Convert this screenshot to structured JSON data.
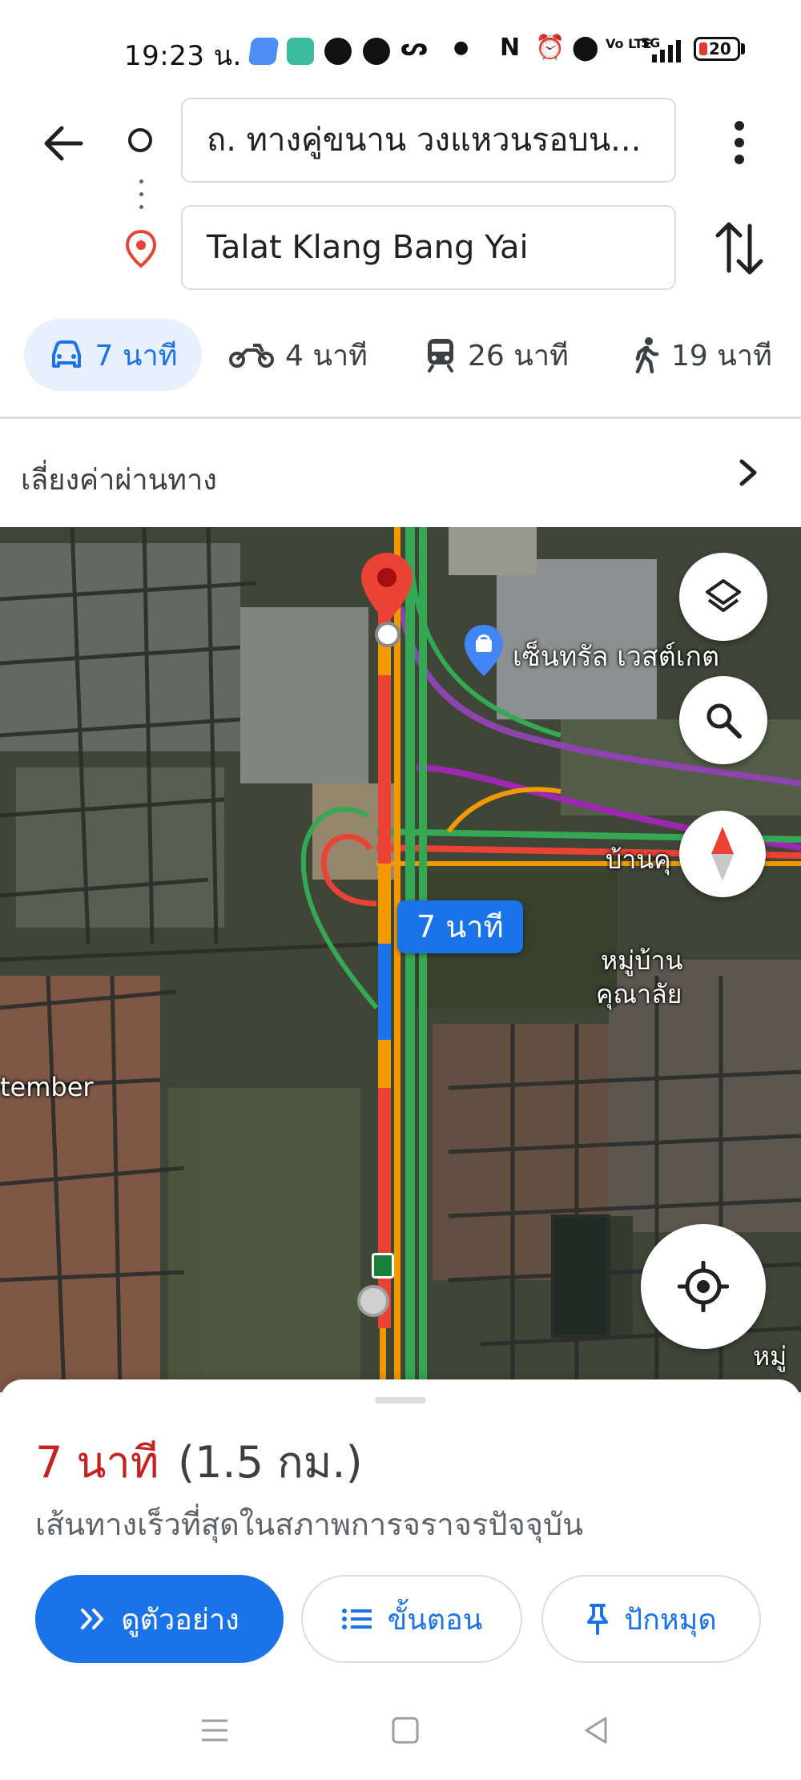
{
  "status_bar": {
    "time": "19:23 น.",
    "battery_level": "20",
    "network": "5G",
    "volte": "Vo LTE"
  },
  "directions": {
    "origin": "ถ. ทางคู่ขนาน วงแหวนรอบน...",
    "destination": "Talat Klang Bang Yai"
  },
  "travel_modes": [
    {
      "mode": "drive",
      "icon": "car-icon",
      "time": "7 นาที",
      "selected": true
    },
    {
      "mode": "motorcycle",
      "icon": "motorcycle-icon",
      "time": "4 นาที",
      "selected": false
    },
    {
      "mode": "transit",
      "icon": "train-icon",
      "time": "26 นาที",
      "selected": false
    },
    {
      "mode": "walk",
      "icon": "walking-icon",
      "time": "19 นาที",
      "selected": false
    }
  ],
  "options": {
    "avoid_tolls": "เลี่ยงค่าผ่านทาง"
  },
  "map": {
    "duration_badge": "7 นาที",
    "place_label": "เซ็นทรัล เวสต์เกต",
    "labels": [
      "บ้านคุ",
      "หมู่บ้าน",
      "คุณาลัย",
      "tember",
      "หมู่"
    ]
  },
  "route": {
    "time": "7 นาที",
    "distance": "(1.5 กม.)",
    "description": "เส้นทางเร็วที่สุดในสภาพการจราจรปัจจุบัน"
  },
  "actions": {
    "preview": "ดูตัวอย่าง",
    "steps": "ขั้นตอน",
    "pin": "ปักหมุด"
  },
  "colors": {
    "accent": "#1a73e8",
    "route_time": "#c5221f",
    "destination_pin": "#ea4335"
  }
}
